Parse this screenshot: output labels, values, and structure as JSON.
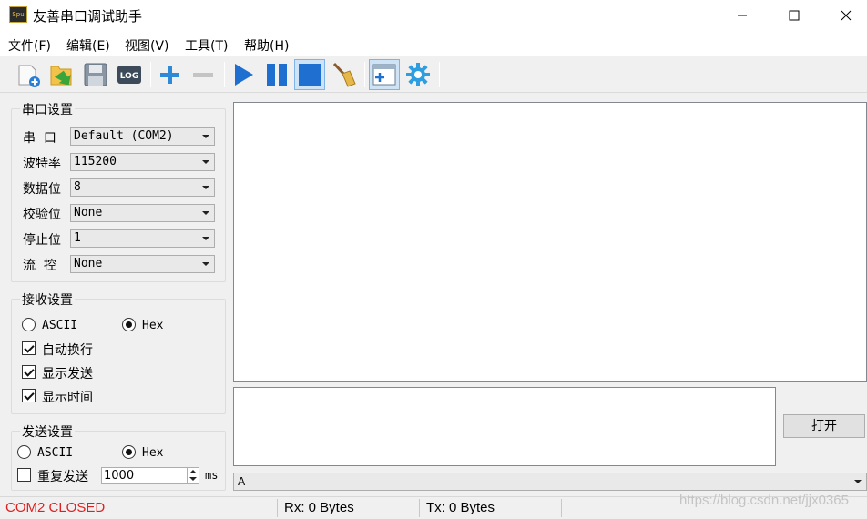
{
  "window": {
    "title": "友善串口调试助手",
    "icon_label": "Spu"
  },
  "menu": [
    {
      "label": "文件(F)"
    },
    {
      "label": "编辑(E)"
    },
    {
      "label": "视图(V)"
    },
    {
      "label": "工具(T)"
    },
    {
      "label": "帮助(H)"
    }
  ],
  "toolbar": {
    "log_label": "LOG",
    "icons": [
      "new-file-icon",
      "open-folder-icon",
      "save-icon",
      "log-icon",
      "add-icon",
      "remove-icon",
      "play-icon",
      "pause-icon",
      "fill-square-icon",
      "broom-icon",
      "add-window-icon",
      "gear-icon"
    ]
  },
  "serial_settings": {
    "title": "串口设置",
    "rows": [
      {
        "label": "串  口",
        "value": "Default (COM2)"
      },
      {
        "label": "波特率",
        "value": "115200"
      },
      {
        "label": "数据位",
        "value": "8"
      },
      {
        "label": "校验位",
        "value": "None"
      },
      {
        "label": "停止位",
        "value": "1"
      },
      {
        "label": "流  控",
        "value": "None"
      }
    ]
  },
  "receive_settings": {
    "title": "接收设置",
    "ascii_label": "ASCII",
    "hex_label": "Hex",
    "mode_selected": "Hex",
    "auto_newline": {
      "label": "自动换行",
      "checked": true
    },
    "show_send": {
      "label": "显示发送",
      "checked": true
    },
    "show_time": {
      "label": "显示时间",
      "checked": true
    }
  },
  "send_settings": {
    "title": "发送设置",
    "ascii_label": "ASCII",
    "hex_label": "Hex",
    "mode_selected": "Hex",
    "repeat": {
      "label": "重复发送",
      "checked": false
    },
    "interval_value": "1000",
    "interval_unit": "ms"
  },
  "open_button": "打开",
  "send_combo_value": "A",
  "status": {
    "port_state": "COM2 CLOSED",
    "rx": "Rx: 0 Bytes",
    "tx": "Tx: 0 Bytes",
    "port_state_color": "#e02020"
  },
  "watermark": "https://blog.csdn.net/jjx0365"
}
